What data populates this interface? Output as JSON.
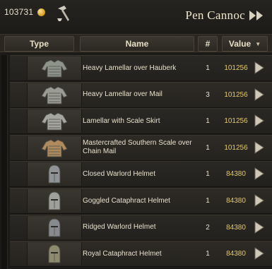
{
  "topbar": {
    "gold_amount": "103731",
    "coin_icon": "gold-coin-icon",
    "hammer_icon": "smithing-hammer-icon",
    "trader_name": "Pen Cannoc",
    "fast_forward_icon": "fast-forward-icon"
  },
  "columns": {
    "type": "Type",
    "name": "Name",
    "qty": "#",
    "value": "Value",
    "value_sort_icon": "sort-descending-icon"
  },
  "items": [
    {
      "name": "Heavy Lamellar over Hauberk",
      "qty": "1",
      "value": "101256",
      "kind": "armor",
      "tint": "#8e948a"
    },
    {
      "name": "Heavy Lamellar over Mail",
      "qty": "3",
      "value": "101256",
      "kind": "armor",
      "tint": "#9a9c94"
    },
    {
      "name": "Lamellar with Scale Skirt",
      "qty": "1",
      "value": "101256",
      "kind": "armor",
      "tint": "#a5a79e"
    },
    {
      "name": "Mastercrafted Southern Scale over Chain Mail",
      "qty": "1",
      "value": "101256",
      "kind": "armor",
      "tint": "#b08a5c"
    },
    {
      "name": "Closed Warlord Helmet",
      "qty": "1",
      "value": "84380",
      "kind": "helmet",
      "tint": "#8f9396"
    },
    {
      "name": "Goggled Cataphract Helmet",
      "qty": "1",
      "value": "84380",
      "kind": "helmet",
      "tint": "#9ea09c"
    },
    {
      "name": "Ridged Warlord Helmet",
      "qty": "2",
      "value": "84380",
      "kind": "helmet",
      "tint": "#878b8e"
    },
    {
      "name": "Royal Cataphract Helmet",
      "qty": "1",
      "value": "84380",
      "kind": "helmet",
      "tint": "#8e8a6e"
    }
  ],
  "colors": {
    "value_text": "#e6c96a",
    "background": "#1b1a18",
    "row": "#2a2824"
  },
  "sell_icon": "sell-arrow-icon"
}
